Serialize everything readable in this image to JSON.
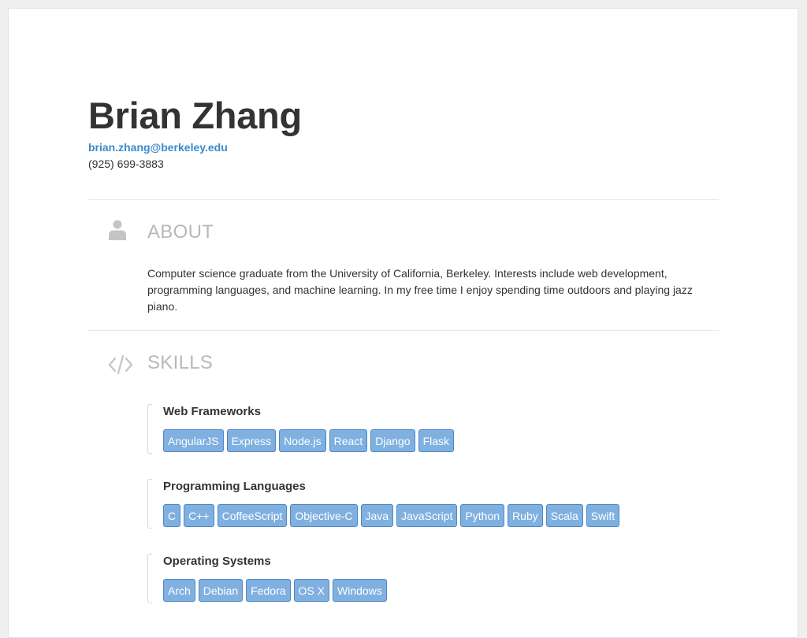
{
  "header": {
    "name": "Brian Zhang",
    "email": "brian.zhang@berkeley.edu",
    "phone": "(925) 699-3883"
  },
  "about": {
    "title": "ABOUT",
    "icon": "user-icon",
    "text": "Computer science graduate from the University of California, Berkeley. Interests include web development, programming languages, and machine learning. In my free time I enjoy spending time outdoors and playing jazz piano."
  },
  "skills": {
    "title": "SKILLS",
    "icon": "code-icon",
    "groups": [
      {
        "title": "Web Frameworks",
        "items": [
          "AngularJS",
          "Express",
          "Node.js",
          "React",
          "Django",
          "Flask"
        ]
      },
      {
        "title": "Programming Languages",
        "items": [
          "C",
          "C++",
          "CoffeeScript",
          "Objective-C",
          "Java",
          "JavaScript",
          "Python",
          "Ruby",
          "Scala",
          "Swift"
        ]
      },
      {
        "title": "Operating Systems",
        "items": [
          "Arch",
          "Debian",
          "Fedora",
          "OS X",
          "Windows"
        ]
      }
    ]
  },
  "colors": {
    "accent": "#3b8ac9",
    "tag_bg": "#7fb0e0",
    "tag_border": "#4e88c4",
    "section_title": "#b8b8b8"
  }
}
